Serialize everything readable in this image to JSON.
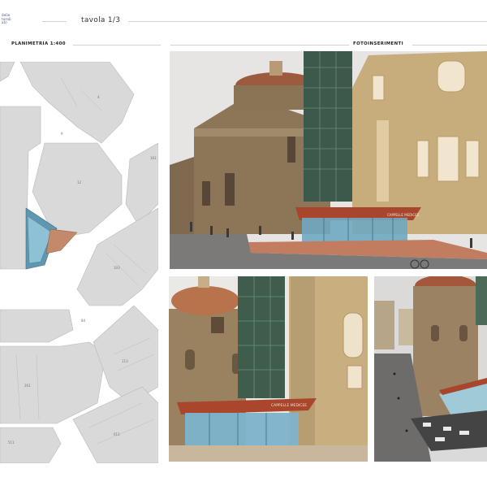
{
  "logo": {
    "text": "delle\nturali\nato"
  },
  "board": {
    "title": "tavola 1/3"
  },
  "sections": {
    "plan_label": "PLANIMETRIA 1:400",
    "photos_label": "FOTOINSERIMENTI"
  },
  "photos": {
    "main_sign": "CAPPELLE MEDICEE",
    "bottom_left_sign": "CAPPELLE MEDICEE"
  },
  "colors": {
    "plan_bg": "#d9d9d9",
    "street": "#ffffff",
    "glass": "#6fa9c2",
    "canopy": "#a8452d",
    "stone": "#8d7658",
    "stucco": "#c8ad7c",
    "sky": "#e7e5e3"
  }
}
